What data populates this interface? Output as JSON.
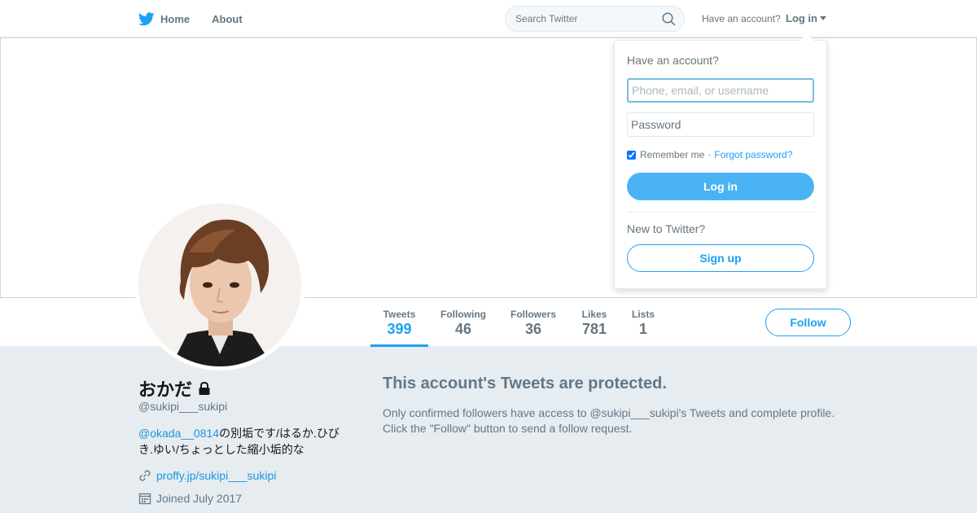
{
  "nav": {
    "home_label": "Home",
    "about_label": "About",
    "home_icon": "twitter-bird-icon",
    "search_placeholder": "Search Twitter",
    "search_icon": "search-icon",
    "account_prompt": "Have an account?",
    "login_label": "Log in",
    "login_icon": "caret-down-icon"
  },
  "profile": {
    "name": "おかだ",
    "name_icon": "lock-icon",
    "screen_name": "@sukipi___sukipi",
    "bio_mention": "@okada__0814",
    "bio_text": "の別垢です/はるか.ひびき.ゆい/ちょっとした縮小垢的な",
    "url_icon": "link-icon",
    "url": "proffy.jp/sukipi___sukipi",
    "joined_icon": "calendar-icon",
    "joined": "Joined July 2017"
  },
  "stats": [
    {
      "label": "Tweets",
      "value": "399",
      "active": true
    },
    {
      "label": "Following",
      "value": "46"
    },
    {
      "label": "Followers",
      "value": "36"
    },
    {
      "label": "Likes",
      "value": "781"
    },
    {
      "label": "Lists",
      "value": "1"
    }
  ],
  "follow_label": "Follow",
  "protected": {
    "title": "This account's Tweets are protected.",
    "description": "Only confirmed followers have access to @sukipi___sukipi's Tweets and complete profile. Click the \"Follow\" button to send a follow request."
  },
  "login_dropdown": {
    "heading": "Have an account?",
    "username_placeholder": "Phone, email, or username",
    "password_placeholder": "Password",
    "remember_label": "Remember me",
    "remember_checked": true,
    "separator": "·",
    "forgot_label": "Forgot password?",
    "login_button": "Log in",
    "new_prompt": "New to Twitter?",
    "signup_button": "Sign up"
  },
  "colors": {
    "accent": "#1da1f2",
    "link": "#1b95e0",
    "login_button": "#4ab3f4",
    "background": "#e6ecf0"
  }
}
